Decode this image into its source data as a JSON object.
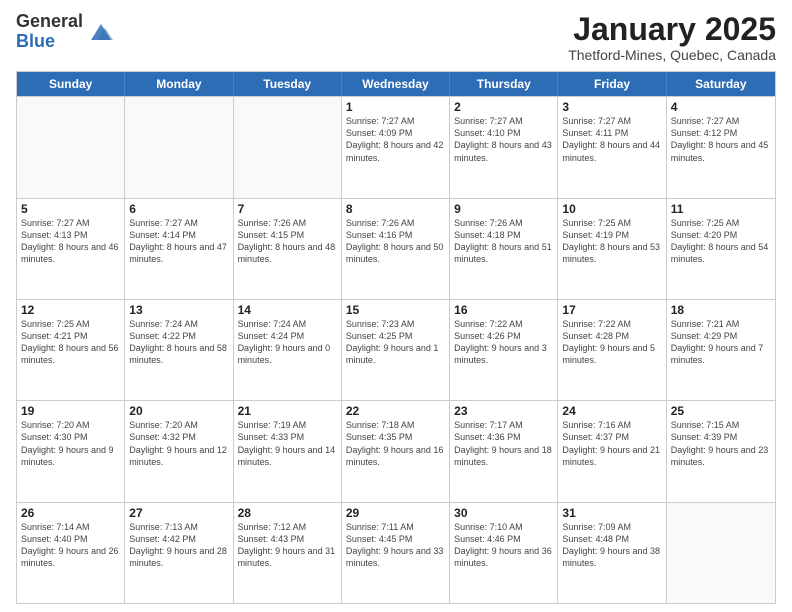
{
  "header": {
    "logo_general": "General",
    "logo_blue": "Blue",
    "month_title": "January 2025",
    "location": "Thetford-Mines, Quebec, Canada"
  },
  "days_of_week": [
    "Sunday",
    "Monday",
    "Tuesday",
    "Wednesday",
    "Thursday",
    "Friday",
    "Saturday"
  ],
  "weeks": [
    [
      {
        "day": "",
        "info": "",
        "empty": true
      },
      {
        "day": "",
        "info": "",
        "empty": true
      },
      {
        "day": "",
        "info": "",
        "empty": true
      },
      {
        "day": "1",
        "info": "Sunrise: 7:27 AM\nSunset: 4:09 PM\nDaylight: 8 hours and 42 minutes."
      },
      {
        "day": "2",
        "info": "Sunrise: 7:27 AM\nSunset: 4:10 PM\nDaylight: 8 hours and 43 minutes."
      },
      {
        "day": "3",
        "info": "Sunrise: 7:27 AM\nSunset: 4:11 PM\nDaylight: 8 hours and 44 minutes."
      },
      {
        "day": "4",
        "info": "Sunrise: 7:27 AM\nSunset: 4:12 PM\nDaylight: 8 hours and 45 minutes."
      }
    ],
    [
      {
        "day": "5",
        "info": "Sunrise: 7:27 AM\nSunset: 4:13 PM\nDaylight: 8 hours and 46 minutes."
      },
      {
        "day": "6",
        "info": "Sunrise: 7:27 AM\nSunset: 4:14 PM\nDaylight: 8 hours and 47 minutes."
      },
      {
        "day": "7",
        "info": "Sunrise: 7:26 AM\nSunset: 4:15 PM\nDaylight: 8 hours and 48 minutes."
      },
      {
        "day": "8",
        "info": "Sunrise: 7:26 AM\nSunset: 4:16 PM\nDaylight: 8 hours and 50 minutes."
      },
      {
        "day": "9",
        "info": "Sunrise: 7:26 AM\nSunset: 4:18 PM\nDaylight: 8 hours and 51 minutes."
      },
      {
        "day": "10",
        "info": "Sunrise: 7:25 AM\nSunset: 4:19 PM\nDaylight: 8 hours and 53 minutes."
      },
      {
        "day": "11",
        "info": "Sunrise: 7:25 AM\nSunset: 4:20 PM\nDaylight: 8 hours and 54 minutes."
      }
    ],
    [
      {
        "day": "12",
        "info": "Sunrise: 7:25 AM\nSunset: 4:21 PM\nDaylight: 8 hours and 56 minutes."
      },
      {
        "day": "13",
        "info": "Sunrise: 7:24 AM\nSunset: 4:22 PM\nDaylight: 8 hours and 58 minutes."
      },
      {
        "day": "14",
        "info": "Sunrise: 7:24 AM\nSunset: 4:24 PM\nDaylight: 9 hours and 0 minutes."
      },
      {
        "day": "15",
        "info": "Sunrise: 7:23 AM\nSunset: 4:25 PM\nDaylight: 9 hours and 1 minute."
      },
      {
        "day": "16",
        "info": "Sunrise: 7:22 AM\nSunset: 4:26 PM\nDaylight: 9 hours and 3 minutes."
      },
      {
        "day": "17",
        "info": "Sunrise: 7:22 AM\nSunset: 4:28 PM\nDaylight: 9 hours and 5 minutes."
      },
      {
        "day": "18",
        "info": "Sunrise: 7:21 AM\nSunset: 4:29 PM\nDaylight: 9 hours and 7 minutes."
      }
    ],
    [
      {
        "day": "19",
        "info": "Sunrise: 7:20 AM\nSunset: 4:30 PM\nDaylight: 9 hours and 9 minutes."
      },
      {
        "day": "20",
        "info": "Sunrise: 7:20 AM\nSunset: 4:32 PM\nDaylight: 9 hours and 12 minutes."
      },
      {
        "day": "21",
        "info": "Sunrise: 7:19 AM\nSunset: 4:33 PM\nDaylight: 9 hours and 14 minutes."
      },
      {
        "day": "22",
        "info": "Sunrise: 7:18 AM\nSunset: 4:35 PM\nDaylight: 9 hours and 16 minutes."
      },
      {
        "day": "23",
        "info": "Sunrise: 7:17 AM\nSunset: 4:36 PM\nDaylight: 9 hours and 18 minutes."
      },
      {
        "day": "24",
        "info": "Sunrise: 7:16 AM\nSunset: 4:37 PM\nDaylight: 9 hours and 21 minutes."
      },
      {
        "day": "25",
        "info": "Sunrise: 7:15 AM\nSunset: 4:39 PM\nDaylight: 9 hours and 23 minutes."
      }
    ],
    [
      {
        "day": "26",
        "info": "Sunrise: 7:14 AM\nSunset: 4:40 PM\nDaylight: 9 hours and 26 minutes."
      },
      {
        "day": "27",
        "info": "Sunrise: 7:13 AM\nSunset: 4:42 PM\nDaylight: 9 hours and 28 minutes."
      },
      {
        "day": "28",
        "info": "Sunrise: 7:12 AM\nSunset: 4:43 PM\nDaylight: 9 hours and 31 minutes."
      },
      {
        "day": "29",
        "info": "Sunrise: 7:11 AM\nSunset: 4:45 PM\nDaylight: 9 hours and 33 minutes."
      },
      {
        "day": "30",
        "info": "Sunrise: 7:10 AM\nSunset: 4:46 PM\nDaylight: 9 hours and 36 minutes."
      },
      {
        "day": "31",
        "info": "Sunrise: 7:09 AM\nSunset: 4:48 PM\nDaylight: 9 hours and 38 minutes."
      },
      {
        "day": "",
        "info": "",
        "empty": true
      }
    ]
  ]
}
